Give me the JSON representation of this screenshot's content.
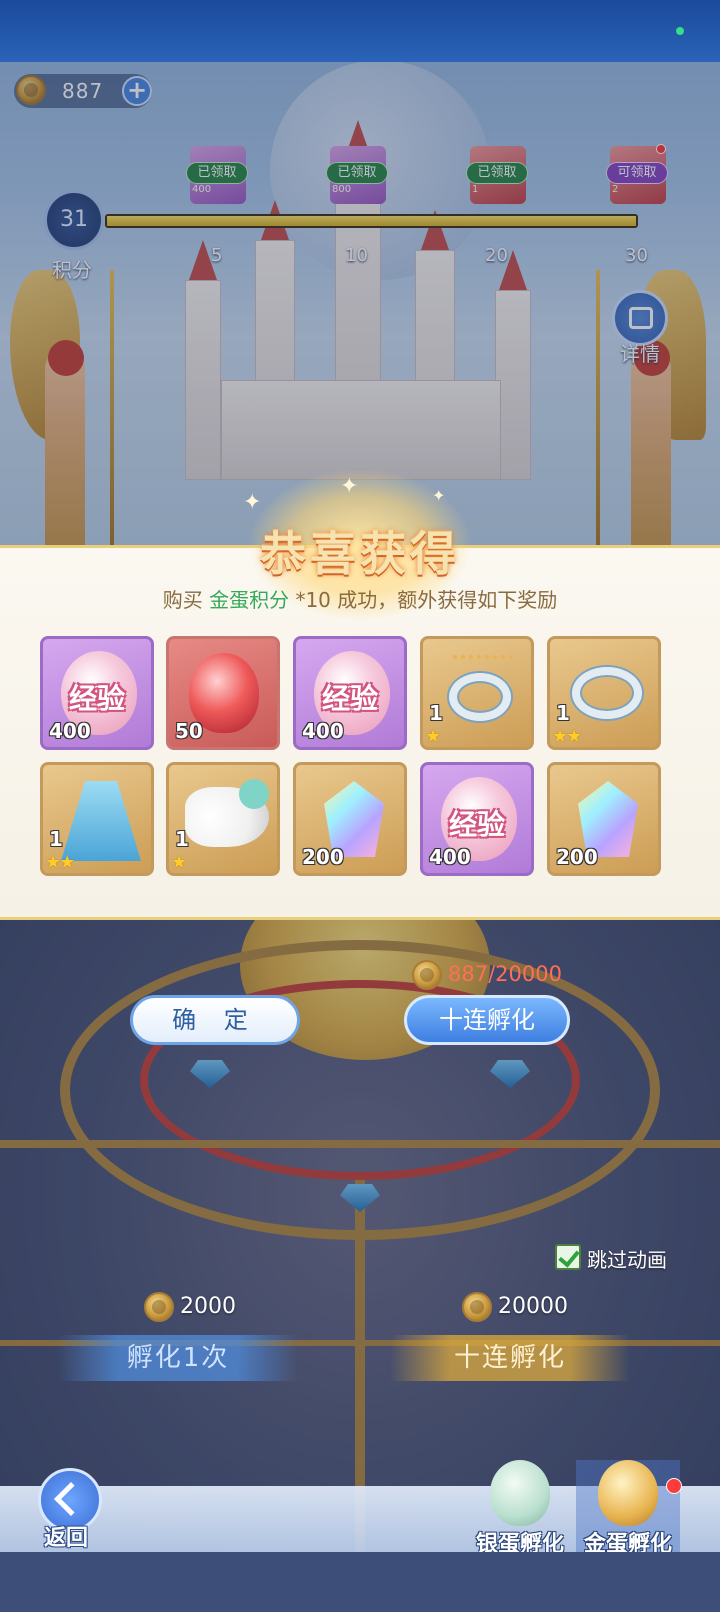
{
  "header": {
    "currency_value": "887"
  },
  "progress": {
    "points": "31",
    "points_label": "积分",
    "fill_fraction": 1.0,
    "milestones": [
      {
        "value": "5",
        "status": "已领取",
        "sub": "400"
      },
      {
        "value": "10",
        "status": "已领取",
        "sub": "800"
      },
      {
        "value": "20",
        "status": "已领取",
        "sub": "1"
      },
      {
        "value": "30",
        "status": "可领取",
        "sub": "2"
      }
    ]
  },
  "detail": {
    "label": "详情"
  },
  "popup": {
    "title": "恭喜获得",
    "msg_prefix": "购买 ",
    "msg_item": "金蛋积分",
    "msg_qty": " *10",
    "msg_suffix": " 成功，额外获得如下奖励",
    "items": [
      {
        "type": "exp",
        "rarity": "purple",
        "label": "经验",
        "qty": "400",
        "stars": 0
      },
      {
        "type": "ruby",
        "rarity": "red",
        "label": "",
        "qty": "50",
        "stars": 0
      },
      {
        "type": "exp",
        "rarity": "purple",
        "label": "经验",
        "qty": "400",
        "stars": 0
      },
      {
        "type": "ring-chain",
        "rarity": "gold",
        "label": "",
        "qty": "1",
        "stars": 1
      },
      {
        "type": "ring-gem",
        "rarity": "gold",
        "label": "",
        "qty": "1",
        "stars": 2
      },
      {
        "type": "cloak",
        "rarity": "gold",
        "label": "",
        "qty": "1",
        "stars": 2
      },
      {
        "type": "horn",
        "rarity": "gold",
        "label": "",
        "qty": "1",
        "stars": 1
      },
      {
        "type": "crystal",
        "rarity": "gold",
        "label": "",
        "qty": "200",
        "stars": 0
      },
      {
        "type": "exp",
        "rarity": "purple",
        "label": "经验",
        "qty": "400",
        "stars": 0
      },
      {
        "type": "crystal",
        "rarity": "gold",
        "label": "",
        "qty": "200",
        "stars": 0
      }
    ]
  },
  "actions": {
    "confirm_label": "确 定",
    "ten_label": "十连孵化",
    "ten_cost": "887/20000"
  },
  "controls": {
    "skip_label": "跳过动画",
    "single_price": "2000",
    "single_label": "孵化1次",
    "ten_price": "20000",
    "ten_label": "十连孵化"
  },
  "bottom": {
    "back_label": "返回",
    "tab_silver": "银蛋孵化",
    "tab_gold": "金蛋孵化"
  },
  "colors": {
    "accent_green": "#36a85a",
    "cost_red": "#ff6f55",
    "rarity_purple": "#b07bd7",
    "rarity_red": "#c95b57",
    "rarity_gold": "#cc9d55"
  }
}
